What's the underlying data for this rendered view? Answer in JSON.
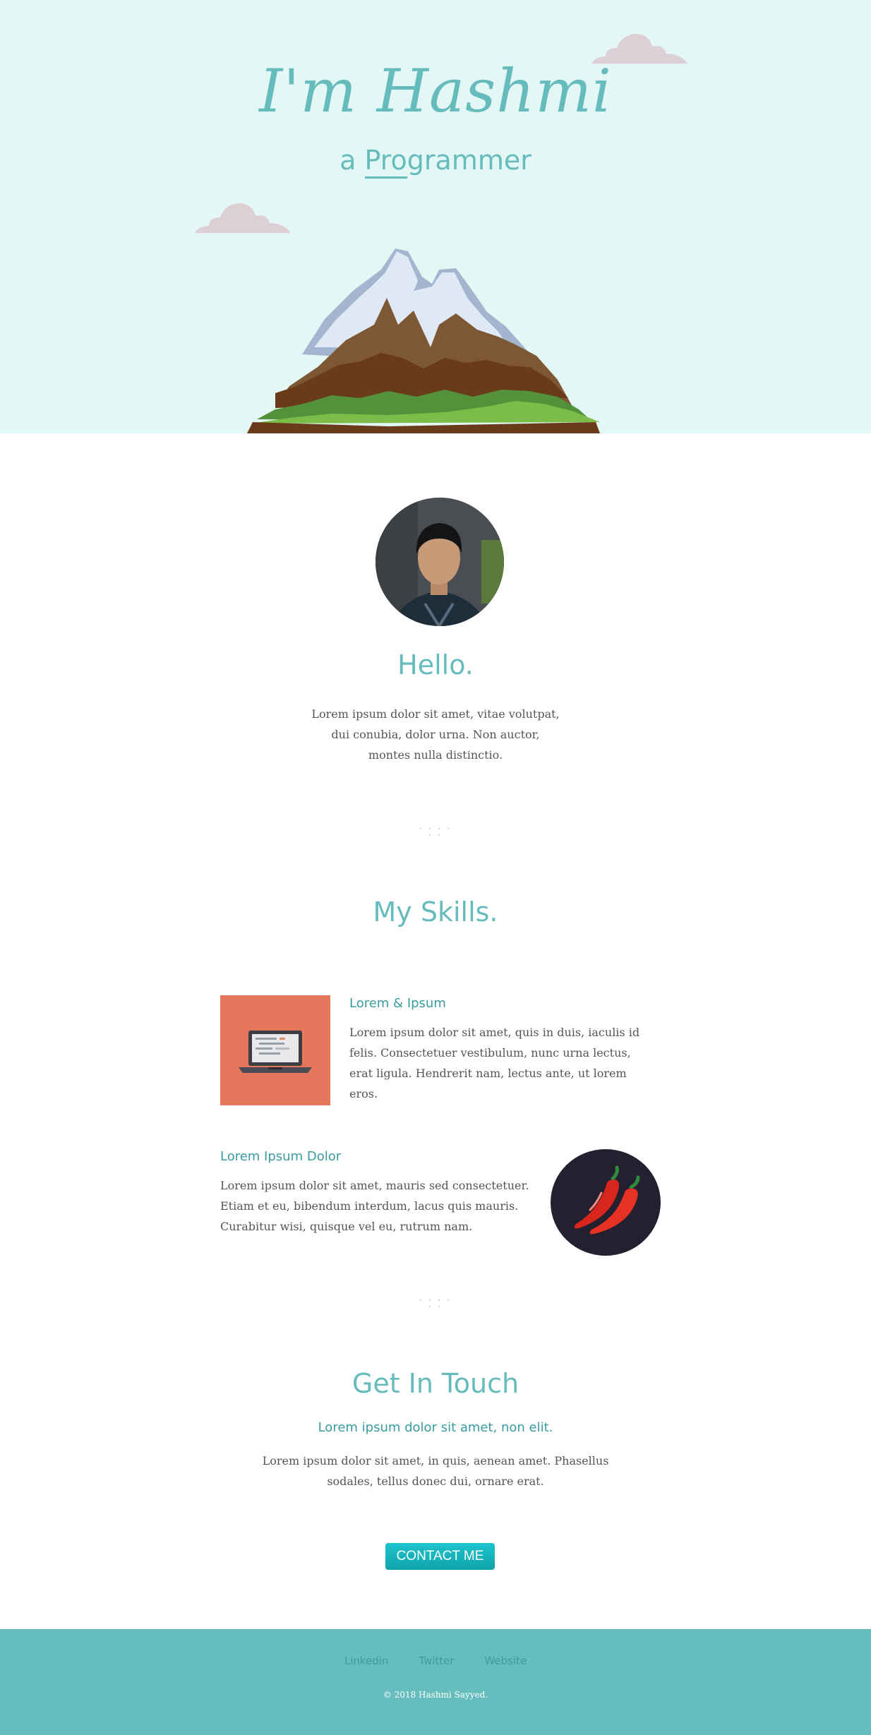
{
  "hero": {
    "title": "I'm Hashmi",
    "subtitle_prefix": "a ",
    "subtitle_typed": "Pro",
    "subtitle_rest": "grammer"
  },
  "about": {
    "heading": "Hello.",
    "text": "Lorem ipsum dolor sit amet, vitae volutpat, dui conubia, dolor urna. Non auctor, montes nulla distinctio."
  },
  "divider": "• • • • • •",
  "skills": {
    "heading": "My Skills.",
    "items": [
      {
        "title": "Lorem & Ipsum",
        "text": "Lorem ipsum dolor sit amet, quis in duis, iaculis id felis. Consectetuer vestibulum, nunc urna lectus, erat ligula. Hendrerit nam, lectus ante, ut lorem eros.",
        "icon": "laptop-icon"
      },
      {
        "title": "Lorem Ipsum Dolor",
        "text": "Lorem ipsum dolor sit amet, mauris sed consectetuer. Etiam et eu, bibendum interdum, lacus quis mauris. Curabitur wisi, quisque vel eu, rutrum nam.",
        "icon": "chili-peppers-icon"
      }
    ]
  },
  "contact": {
    "heading": "Get In Touch",
    "subheading": "Lorem ipsum dolor sit amet, non elit.",
    "text": "Lorem ipsum dolor sit amet, in quis, aenean amet. Phasellus sodales, tellus donec dui, ornare erat.",
    "button": "CONTACT ME"
  },
  "footer": {
    "links": [
      "Linkedin",
      "Twitter",
      "Website"
    ],
    "copyright": "© 2018 Hashmi Sayyed."
  },
  "colors": {
    "hero_bg": "#e3f7f4",
    "accent": "#66bcbd",
    "accent_dark": "#3a9ca0",
    "button": "#1dc3cb",
    "footer_bg": "#66bdbd",
    "skill_card_bg": "#e5775c",
    "skill_circle_bg": "#25202f"
  }
}
